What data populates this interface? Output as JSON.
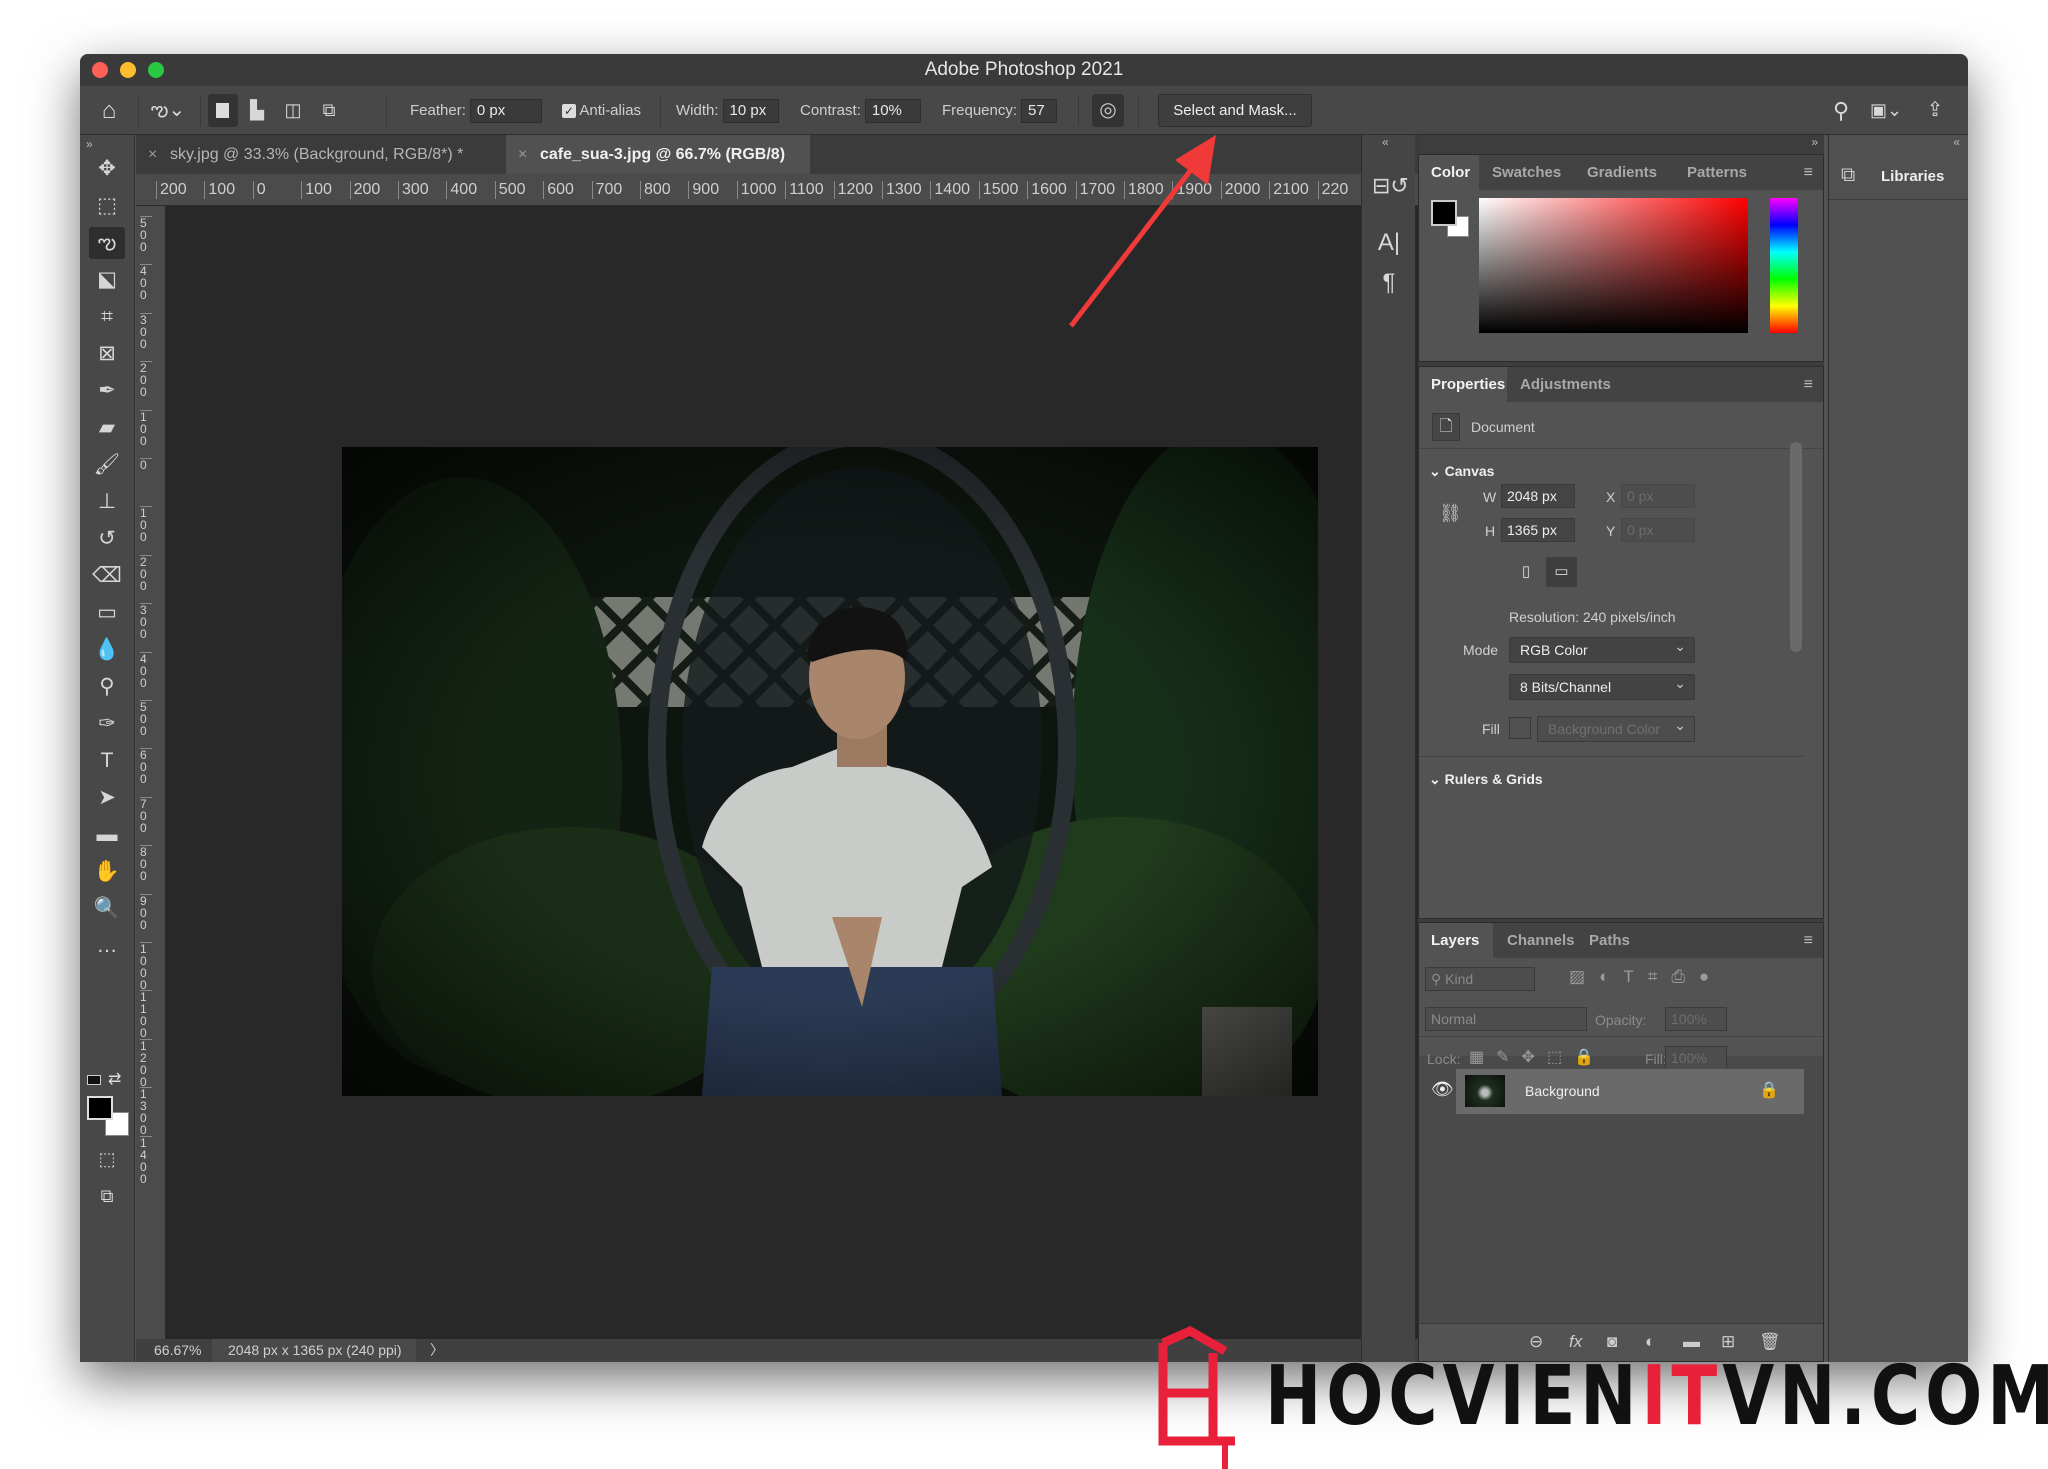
{
  "window": {
    "title": "Adobe Photoshop 2021"
  },
  "options_bar": {
    "feather_label": "Feather:",
    "feather_value": "0 px",
    "antialias_label": "Anti-alias",
    "antialias_checked": true,
    "width_label": "Width:",
    "width_value": "10 px",
    "contrast_label": "Contrast:",
    "contrast_value": "10%",
    "frequency_label": "Frequency:",
    "frequency_value": "57",
    "select_and_mask": "Select and Mask..."
  },
  "doc_tabs": [
    {
      "label": "sky.jpg @ 33.3% (Background, RGB/8*) *",
      "active": false
    },
    {
      "label": "cafe_sua-3.jpg @ 66.7% (RGB/8)",
      "active": true
    }
  ],
  "ruler_top": [
    "200",
    "100",
    "0",
    "100",
    "200",
    "300",
    "400",
    "500",
    "600",
    "700",
    "800",
    "900",
    "1000",
    "1100",
    "1200",
    "1300",
    "1400",
    "1500",
    "1600",
    "1700",
    "1800",
    "1900",
    "2000",
    "2100",
    "220"
  ],
  "ruler_left": [
    "500",
    "400",
    "300",
    "200",
    "100",
    "0",
    "100",
    "200",
    "300",
    "400",
    "500",
    "600",
    "700",
    "800",
    "900",
    "1000",
    "1100",
    "1200",
    "1300",
    "1400"
  ],
  "status": {
    "zoom": "66.67%",
    "info": "2048 px x 1365 px (240 ppi)",
    "arrow": "〉"
  },
  "tools": [
    "move-tool",
    "rectangular-marquee-tool",
    "magnetic-lasso-tool",
    "object-selection-tool",
    "crop-tool",
    "frame-tool",
    "eyedropper-tool",
    "healing-brush-tool",
    "brush-tool",
    "clone-stamp-tool",
    "history-brush-tool",
    "eraser-tool",
    "gradient-tool",
    "blur-tool",
    "dodge-tool",
    "pen-tool",
    "type-tool",
    "path-selection-tool",
    "rectangle-tool",
    "hand-tool",
    "zoom-tool",
    "more-tools"
  ],
  "colors": {
    "foreground": "#000000",
    "background": "#ffffff",
    "arrow": "#f03a3a",
    "hue": "#ff0000"
  },
  "color_panel": {
    "tabs": [
      "Color",
      "Swatches",
      "Gradients",
      "Patterns"
    ]
  },
  "properties_panel": {
    "tabs": [
      "Properties",
      "Adjustments"
    ],
    "document_label": "Document",
    "canvas_section": "Canvas",
    "w_label": "W",
    "w_value": "2048 px",
    "h_label": "H",
    "h_value": "1365 px",
    "x_label": "X",
    "x_value": "0 px",
    "y_label": "Y",
    "y_value": "0 px",
    "resolution": "Resolution: 240 pixels/inch",
    "mode_label": "Mode",
    "mode_value": "RGB Color",
    "bits_value": "8 Bits/Channel",
    "fill_label": "Fill",
    "fill_value": "Background Color",
    "rulers_section": "Rulers & Grids"
  },
  "layers_panel": {
    "tabs": [
      "Layers",
      "Channels",
      "Paths"
    ],
    "kind_placeholder": "Kind",
    "blend_mode": "Normal",
    "opacity_label": "Opacity:",
    "opacity_value": "100%",
    "lock_label": "Lock:",
    "fill_label": "Fill:",
    "fill_value": "100%",
    "layers": [
      {
        "name": "Background",
        "visible": true,
        "locked": true
      }
    ]
  },
  "libraries": {
    "label": "Libraries"
  },
  "watermark": {
    "text_a": "HOCVIEN",
    "text_b": "IT",
    "text_c": "VN.COM"
  }
}
